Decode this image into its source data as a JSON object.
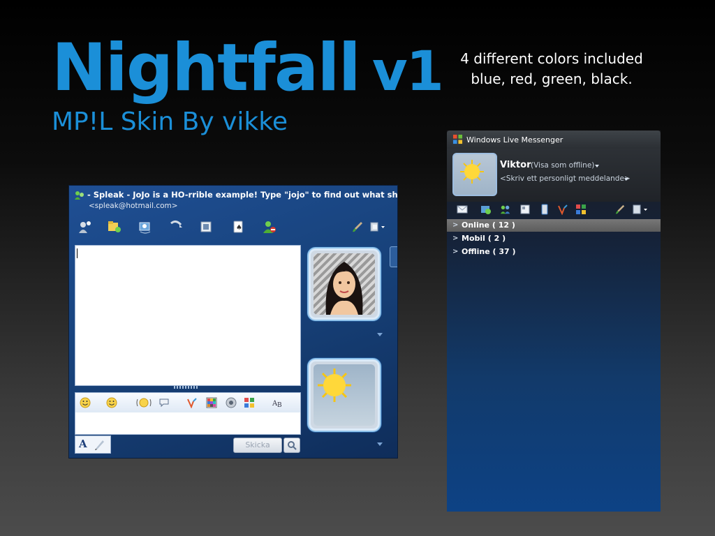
{
  "title": "Nightfall",
  "version": "v1",
  "subtitle": "MP!L Skin By vikke",
  "notes": [
    "4 different colors included",
    "blue, red, green, black."
  ],
  "chat": {
    "title": "- Spleak - JoJo is a HO-rrible example! Type \"jojo\" to find out what she did!",
    "email": "<spleak@hotmail.com>",
    "send_label": "Skicka",
    "toolbar_icons": [
      "invite-contact-icon",
      "send-files-icon",
      "video-call-icon",
      "voice-call-icon",
      "share-folders-icon",
      "games-icon",
      "block-icon",
      "paint-brush-icon",
      "layout-menu-icon"
    ],
    "emoticon_icons": [
      "smiley-icon",
      "wink-icon",
      "nudge-icon",
      "voice-clip-icon",
      "wink-flash-icon",
      "background-icon",
      "sound-icon",
      "games-icon",
      "font-icon"
    ]
  },
  "messenger": {
    "app_title": "Windows Live Messenger",
    "user_name": "Viktor",
    "status": "(Visa som offline)",
    "personal_message": "<Skriv ett personligt meddelande>",
    "groups": [
      {
        "label": "Online ( 12 )",
        "selected": true
      },
      {
        "label": "Mobil ( 2 )",
        "selected": false
      },
      {
        "label": "Offline ( 37 )",
        "selected": false
      }
    ]
  },
  "colors": {
    "accent": "#1b8fd8",
    "panel_blue": "#123a6a"
  }
}
